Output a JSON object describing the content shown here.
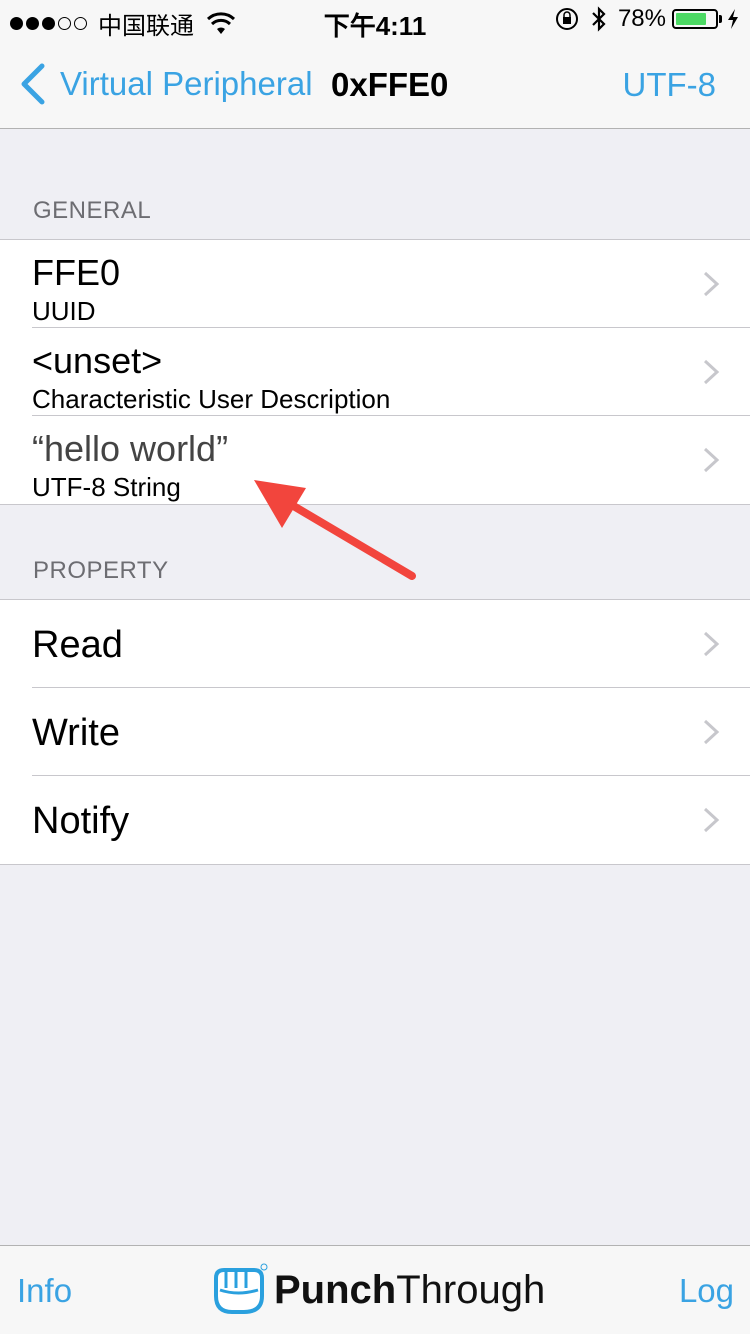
{
  "status_bar": {
    "carrier": "中国联通",
    "time": "下午4:11",
    "battery_percent_label": "78%",
    "battery_level": 0.78,
    "icons": [
      "signal-dots-icon",
      "wifi-icon",
      "orientation-lock-icon",
      "bluetooth-icon",
      "battery-icon",
      "charging-icon"
    ]
  },
  "nav": {
    "back_label": "Virtual Peripheral",
    "title": "0xFFE0",
    "right_label": "UTF-8"
  },
  "sections": {
    "general": {
      "header": "GENERAL",
      "rows": [
        {
          "title": "FFE0",
          "subtitle": "UUID"
        },
        {
          "title": "<unset>",
          "subtitle": "Characteristic User Description"
        },
        {
          "title": "“hello world”",
          "subtitle": "UTF-8 String"
        }
      ]
    },
    "property": {
      "header": "PROPERTY",
      "rows": [
        {
          "title": "Read"
        },
        {
          "title": "Write"
        },
        {
          "title": "Notify"
        }
      ]
    }
  },
  "tab_bar": {
    "left_label": "Info",
    "brand_bold": "Punch",
    "brand_regular": "Through",
    "right_label": "Log"
  },
  "colors": {
    "accent": "#3aa3e3",
    "background": "#efeff4",
    "annotation_arrow": "#f2453d",
    "battery_fill": "#4cd964"
  }
}
